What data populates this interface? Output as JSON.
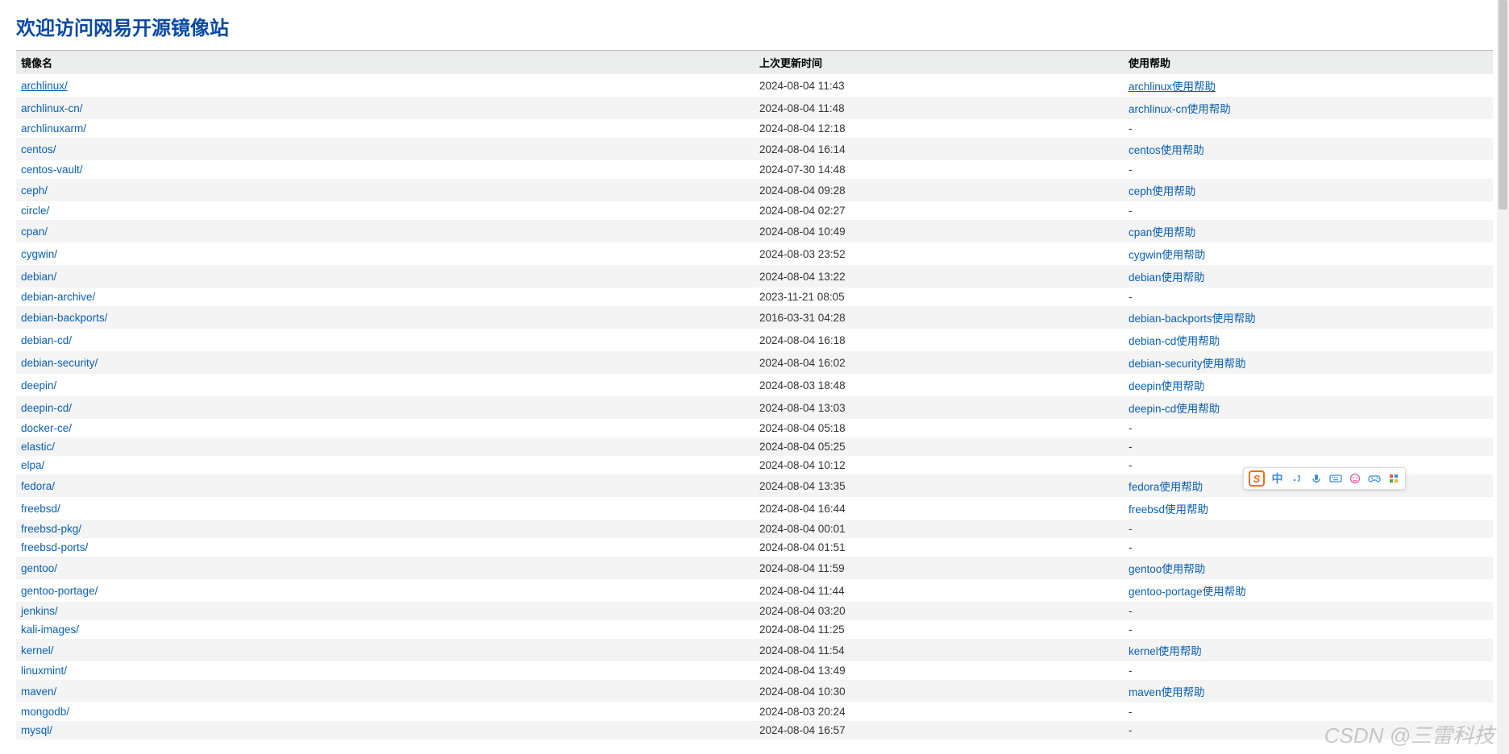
{
  "page": {
    "title": "欢迎访问网易开源镜像站"
  },
  "table": {
    "headers": {
      "name": "镜像名",
      "time": "上次更新时间",
      "help": "使用帮助"
    },
    "rows": [
      {
        "name": "archlinux/",
        "time": "2024-08-04 11:43",
        "help": "archlinux使用帮助"
      },
      {
        "name": "archlinux-cn/",
        "time": "2024-08-04 11:48",
        "help": "archlinux-cn使用帮助"
      },
      {
        "name": "archlinuxarm/",
        "time": "2024-08-04 12:18",
        "help": "-"
      },
      {
        "name": "centos/",
        "time": "2024-08-04 16:14",
        "help": "centos使用帮助"
      },
      {
        "name": "centos-vault/",
        "time": "2024-07-30 14:48",
        "help": "-"
      },
      {
        "name": "ceph/",
        "time": "2024-08-04 09:28",
        "help": "ceph使用帮助"
      },
      {
        "name": "circle/",
        "time": "2024-08-04 02:27",
        "help": "-"
      },
      {
        "name": "cpan/",
        "time": "2024-08-04 10:49",
        "help": "cpan使用帮助"
      },
      {
        "name": "cygwin/",
        "time": "2024-08-03 23:52",
        "help": "cygwin使用帮助"
      },
      {
        "name": "debian/",
        "time": "2024-08-04 13:22",
        "help": "debian使用帮助"
      },
      {
        "name": "debian-archive/",
        "time": "2023-11-21 08:05",
        "help": "-"
      },
      {
        "name": "debian-backports/",
        "time": "2016-03-31 04:28",
        "help": "debian-backports使用帮助"
      },
      {
        "name": "debian-cd/",
        "time": "2024-08-04 16:18",
        "help": "debian-cd使用帮助"
      },
      {
        "name": "debian-security/",
        "time": "2024-08-04 16:02",
        "help": "debian-security使用帮助"
      },
      {
        "name": "deepin/",
        "time": "2024-08-03 18:48",
        "help": "deepin使用帮助"
      },
      {
        "name": "deepin-cd/",
        "time": "2024-08-04 13:03",
        "help": "deepin-cd使用帮助"
      },
      {
        "name": "docker-ce/",
        "time": "2024-08-04 05:18",
        "help": "-"
      },
      {
        "name": "elastic/",
        "time": "2024-08-04 05:25",
        "help": "-"
      },
      {
        "name": "elpa/",
        "time": "2024-08-04 10:12",
        "help": "-"
      },
      {
        "name": "fedora/",
        "time": "2024-08-04 13:35",
        "help": "fedora使用帮助"
      },
      {
        "name": "freebsd/",
        "time": "2024-08-04 16:44",
        "help": "freebsd使用帮助"
      },
      {
        "name": "freebsd-pkg/",
        "time": "2024-08-04 00:01",
        "help": "-"
      },
      {
        "name": "freebsd-ports/",
        "time": "2024-08-04 01:51",
        "help": "-"
      },
      {
        "name": "gentoo/",
        "time": "2024-08-04 11:59",
        "help": "gentoo使用帮助"
      },
      {
        "name": "gentoo-portage/",
        "time": "2024-08-04 11:44",
        "help": "gentoo-portage使用帮助"
      },
      {
        "name": "jenkins/",
        "time": "2024-08-04 03:20",
        "help": "-"
      },
      {
        "name": "kali-images/",
        "time": "2024-08-04 11:25",
        "help": "-"
      },
      {
        "name": "kernel/",
        "time": "2024-08-04 11:54",
        "help": "kernel使用帮助"
      },
      {
        "name": "linuxmint/",
        "time": "2024-08-04 13:49",
        "help": "-"
      },
      {
        "name": "maven/",
        "time": "2024-08-04 10:30",
        "help": "maven使用帮助"
      },
      {
        "name": "mongodb/",
        "time": "2024-08-03 20:24",
        "help": "-"
      },
      {
        "name": "mysql/",
        "time": "2024-08-04 16:57",
        "help": "-"
      }
    ]
  },
  "ime": {
    "logo": "S",
    "lang": "中",
    "icons": [
      "punct",
      "mic",
      "keyboard",
      "emoji",
      "game",
      "grid"
    ]
  },
  "watermark": "CSDN @三雷科技"
}
